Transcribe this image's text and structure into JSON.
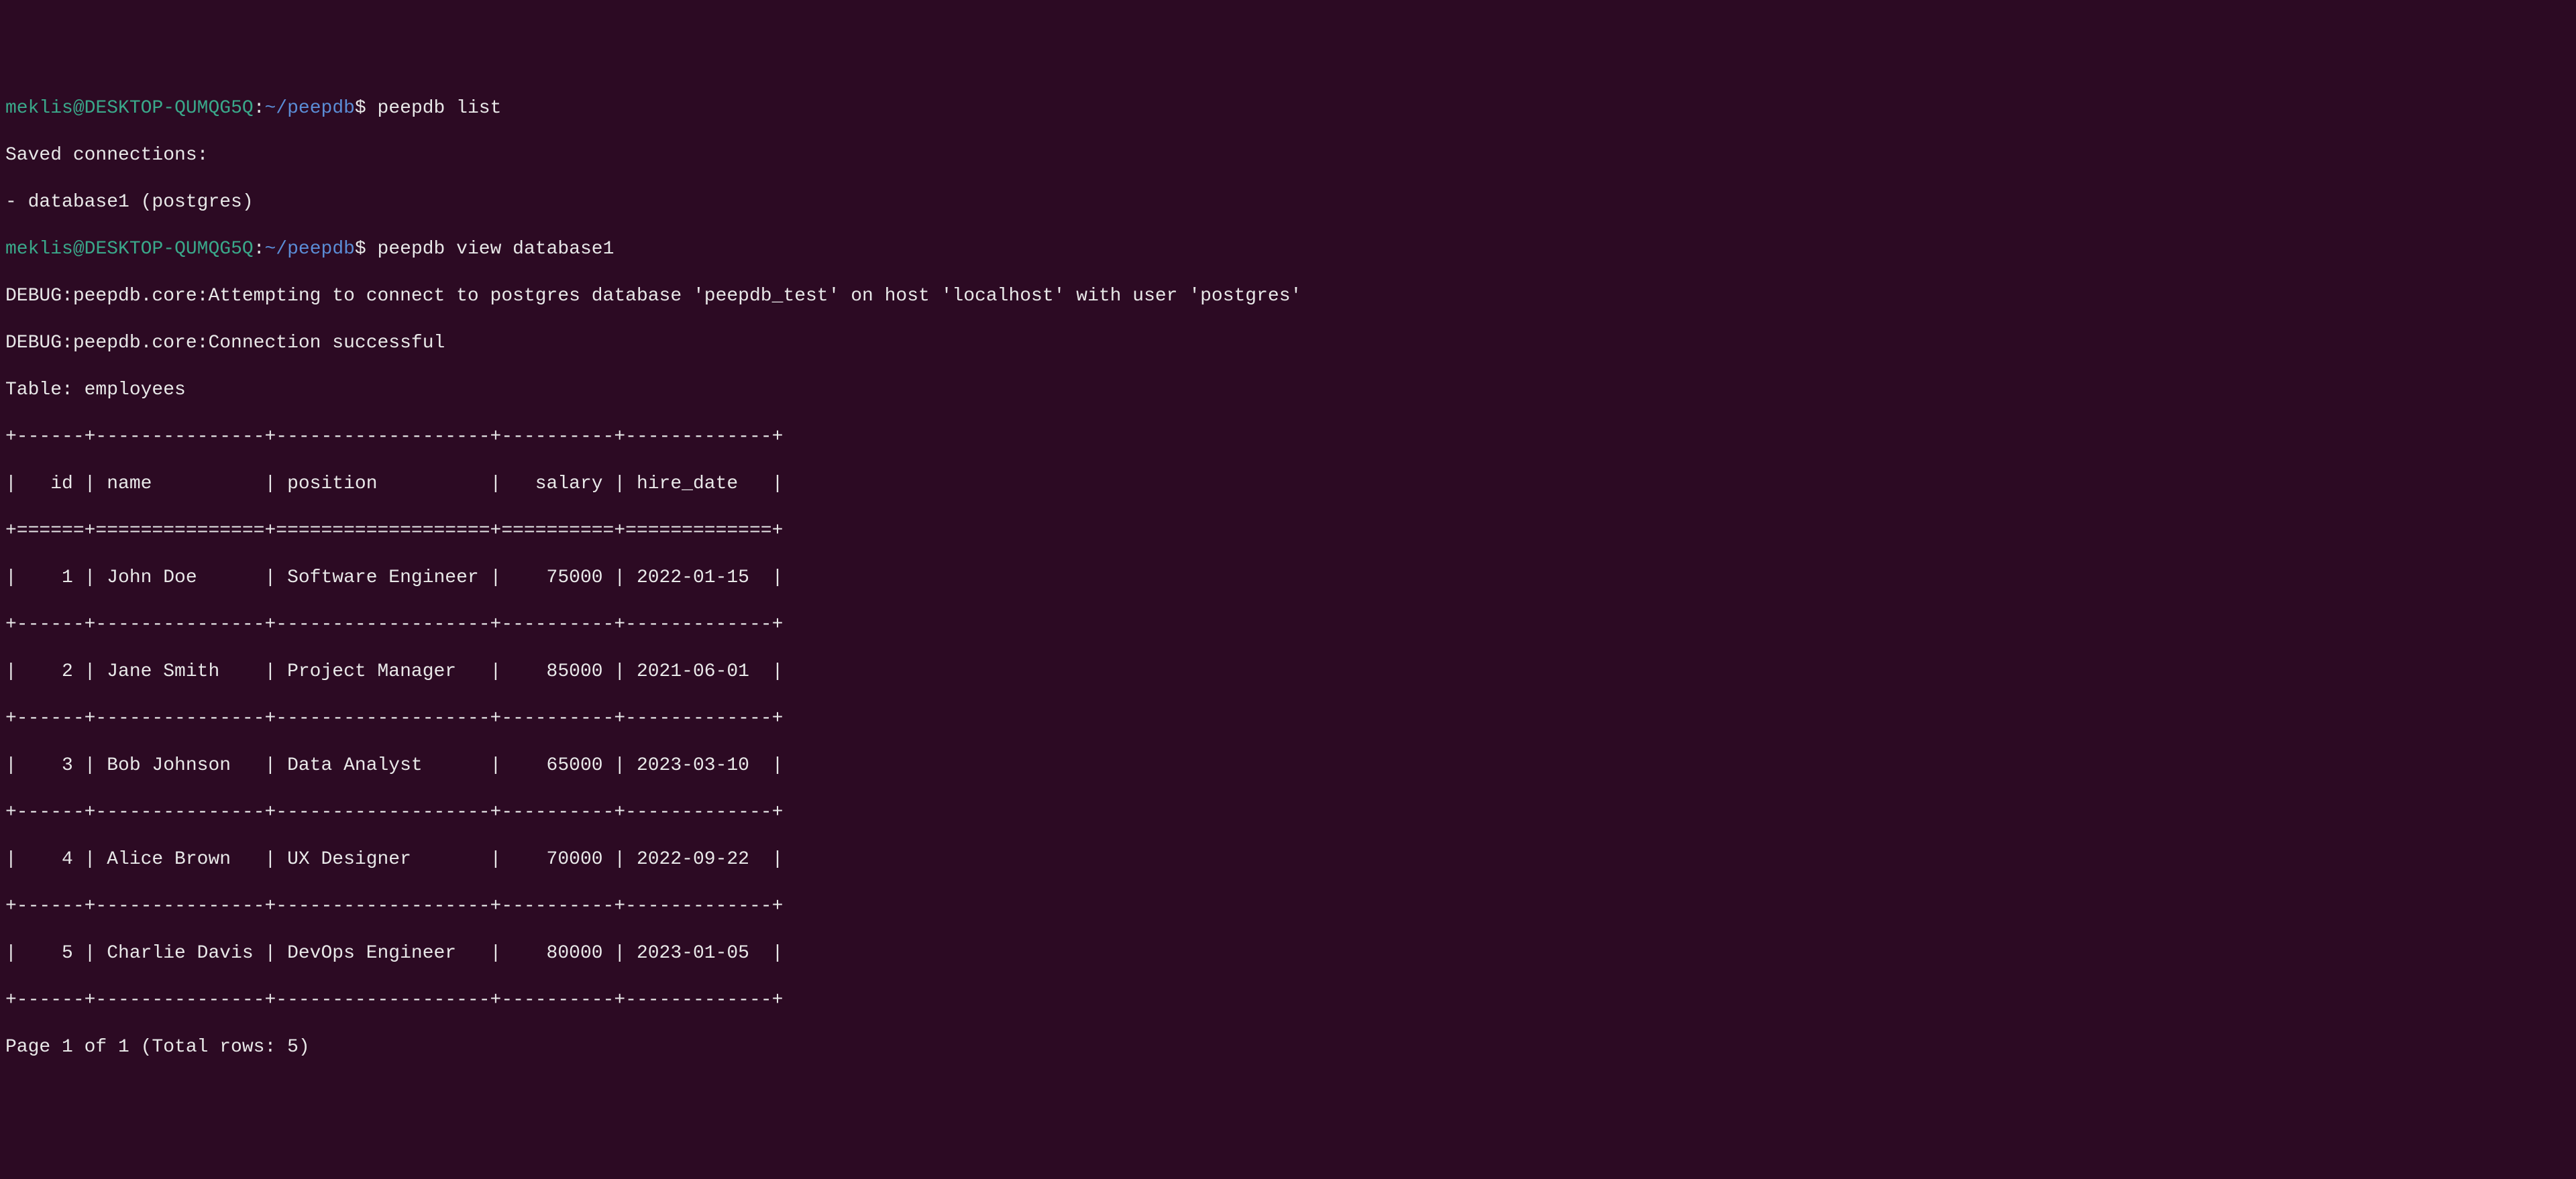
{
  "prompt1": {
    "user": "meklis",
    "at": "@",
    "host": "DESKTOP-QUMQG5Q",
    "colon": ":",
    "path": "~/peepdb",
    "dollar": "$",
    "space": " ",
    "command": "peepdb list"
  },
  "output1": {
    "line1": "Saved connections:",
    "line2": "- database1 (postgres)"
  },
  "prompt2": {
    "user": "meklis",
    "at": "@",
    "host": "DESKTOP-QUMQG5Q",
    "colon": ":",
    "path": "~/peepdb",
    "dollar": "$",
    "space": " ",
    "command": "peepdb view database1"
  },
  "output2": {
    "debug1": "DEBUG:peepdb.core:Attempting to connect to postgres database 'peepdb_test' on host 'localhost' with user 'postgres'",
    "debug2": "DEBUG:peepdb.core:Connection successful",
    "tableTitle": "Table: employees",
    "sep1": "+------+---------------+-------------------+----------+-------------+",
    "header": "|   id | name          | position          |   salary | hire_date   |",
    "sep2": "+======+===============+===================+==========+=============+",
    "row1": "|    1 | John Doe      | Software Engineer |    75000 | 2022-01-15  |",
    "sep3": "+------+---------------+-------------------+----------+-------------+",
    "row2": "|    2 | Jane Smith    | Project Manager   |    85000 | 2021-06-01  |",
    "sep4": "+------+---------------+-------------------+----------+-------------+",
    "row3": "|    3 | Bob Johnson   | Data Analyst      |    65000 | 2023-03-10  |",
    "sep5": "+------+---------------+-------------------+----------+-------------+",
    "row4": "|    4 | Alice Brown   | UX Designer       |    70000 | 2022-09-22  |",
    "sep6": "+------+---------------+-------------------+----------+-------------+",
    "row5": "|    5 | Charlie Davis | DevOps Engineer   |    80000 | 2023-01-05  |",
    "sep7": "+------+---------------+-------------------+----------+-------------+",
    "pagination": "Page 1 of 1 (Total rows: 5)"
  }
}
